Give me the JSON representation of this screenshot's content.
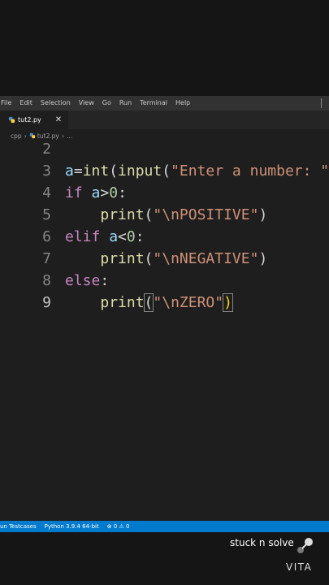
{
  "menu": [
    "File",
    "Edit",
    "Selection",
    "View",
    "Go",
    "Run",
    "Terminal",
    "Help"
  ],
  "tab": {
    "label": "tut2.py",
    "close": "✕"
  },
  "breadcrumb": {
    "folder": "cpp",
    "file": "tut2.py",
    "more": "..."
  },
  "editor": {
    "lines": [
      {
        "num": "2"
      },
      {
        "num": "3"
      },
      {
        "num": "4"
      },
      {
        "num": "5"
      },
      {
        "num": "6"
      },
      {
        "num": "7"
      },
      {
        "num": "8"
      },
      {
        "num": "9"
      }
    ],
    "tokens": {
      "l3_a": "a",
      "l3_eq": "=",
      "l3_int": "int",
      "l3_p1": "(",
      "l3_input": "input",
      "l3_p2": "(",
      "l3_str": "\"Enter a number: \"",
      "l4_if": "if",
      "l4_a": " a",
      "l4_cmp": ">",
      "l4_num": "0",
      "l4_colon": ":",
      "l5_indent": "    ",
      "l5_print": "print",
      "l5_p1": "(",
      "l5_str": "\"\\nPOSITIVE\"",
      "l5_p2": ")",
      "l6_elif": "elif",
      "l6_a": " a",
      "l6_cmp": "<",
      "l6_num": "0",
      "l6_colon": ":",
      "l7_indent": "    ",
      "l7_print": "print",
      "l7_p1": "(",
      "l7_str": "\"\\nNEGATIVE\"",
      "l7_p2": ")",
      "l8_else": "else",
      "l8_colon": ":",
      "l9_indent": "    ",
      "l9_print": "print",
      "l9_p1": "(",
      "l9_str": "\"\\nZERO\"",
      "l9_p2": ")"
    }
  },
  "status": {
    "run": "un Testcases",
    "python": "Python 3.9.4 64-bit",
    "problems": "⊗ 0 ⚠ 0"
  },
  "overlay": {
    "watermark": "stuck n solve",
    "brand": "VITA"
  },
  "colors": {
    "statusbar": "#007acc",
    "keyword": "#c586c0",
    "string": "#ce9178",
    "function": "#dcdcaa"
  }
}
